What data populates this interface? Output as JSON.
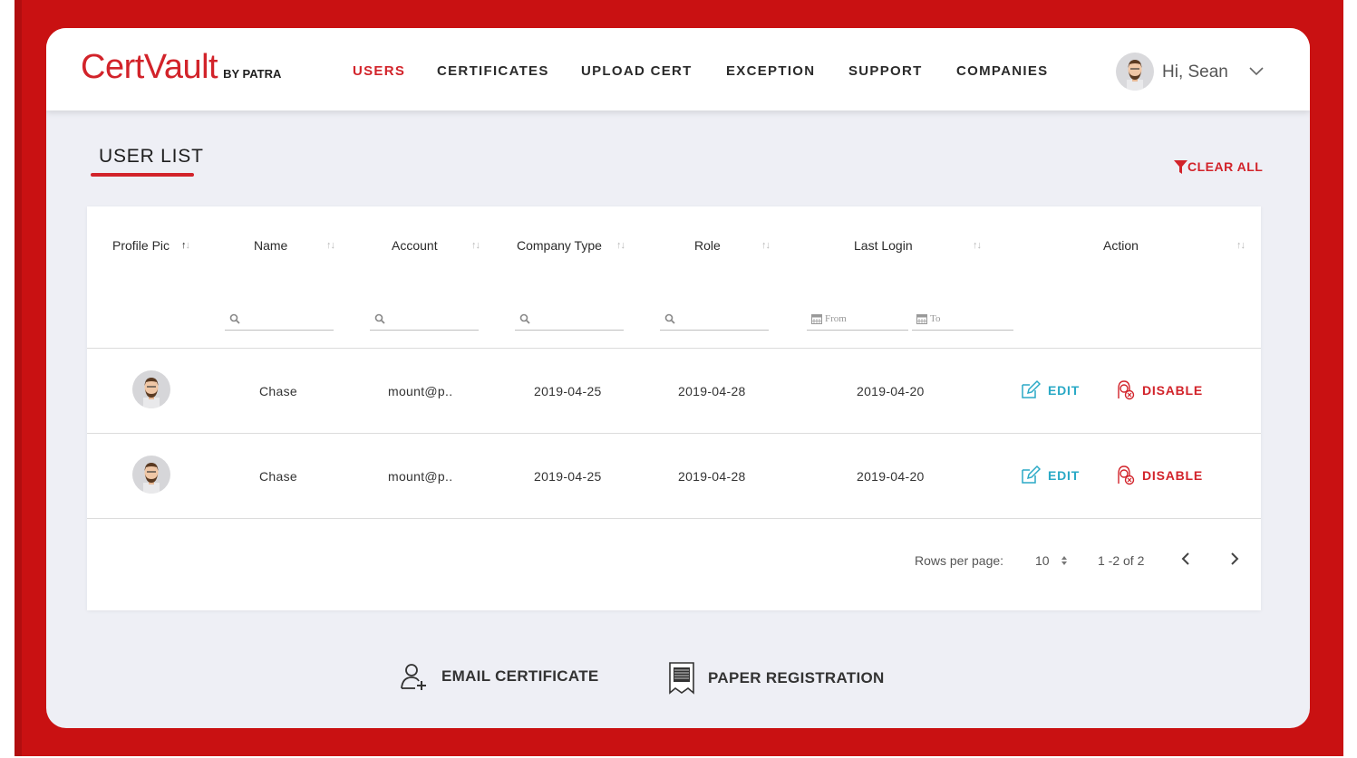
{
  "brand": {
    "name": "CertVault",
    "by": "BY PATRA",
    "accent": "#d2232a",
    "frame": "#c91112"
  },
  "nav": [
    {
      "label": "USERS",
      "active": true
    },
    {
      "label": "CERTIFICATES",
      "active": false
    },
    {
      "label": "UPLOAD CERT",
      "active": false
    },
    {
      "label": "EXCEPTION",
      "active": false
    },
    {
      "label": "SUPPORT",
      "active": false
    },
    {
      "label": "COMPANIES",
      "active": false
    }
  ],
  "user": {
    "greeting": "Hi, Sean",
    "menu_icon": "chevron-down-icon"
  },
  "page": {
    "title": "USER LIST",
    "clear_all": "CLEAR ALL"
  },
  "table": {
    "columns": [
      {
        "label": "Profile Pic",
        "sort": "ascending"
      },
      {
        "label": "Name",
        "sort": "none"
      },
      {
        "label": "Account",
        "sort": "none"
      },
      {
        "label": "Company Type",
        "sort": "none"
      },
      {
        "label": "Role",
        "sort": "none"
      },
      {
        "label": "Last Login",
        "sort": "none"
      },
      {
        "label": "Action",
        "sort": "none"
      }
    ],
    "filters": {
      "date_from": "From",
      "date_to": "To"
    },
    "rows": [
      {
        "name": "Chase",
        "account": "mount@p..",
        "company_type": "2019-04-25",
        "role": "2019-04-28",
        "last_login": "2019-04-20",
        "edit": "EDIT",
        "disable": "DISABLE"
      },
      {
        "name": "Chase",
        "account": "mount@p..",
        "company_type": "2019-04-25",
        "role": "2019-04-28",
        "last_login": "2019-04-20",
        "edit": "EDIT",
        "disable": "DISABLE"
      }
    ],
    "pagination": {
      "rows_per_page_label": "Rows per page:",
      "rows_per_page": "10",
      "range": "1 -2 of 2"
    }
  },
  "actions": {
    "email_certificate": "EMAIL CERTIFICATE",
    "paper_registration": "PAPER REGISTRATION"
  }
}
